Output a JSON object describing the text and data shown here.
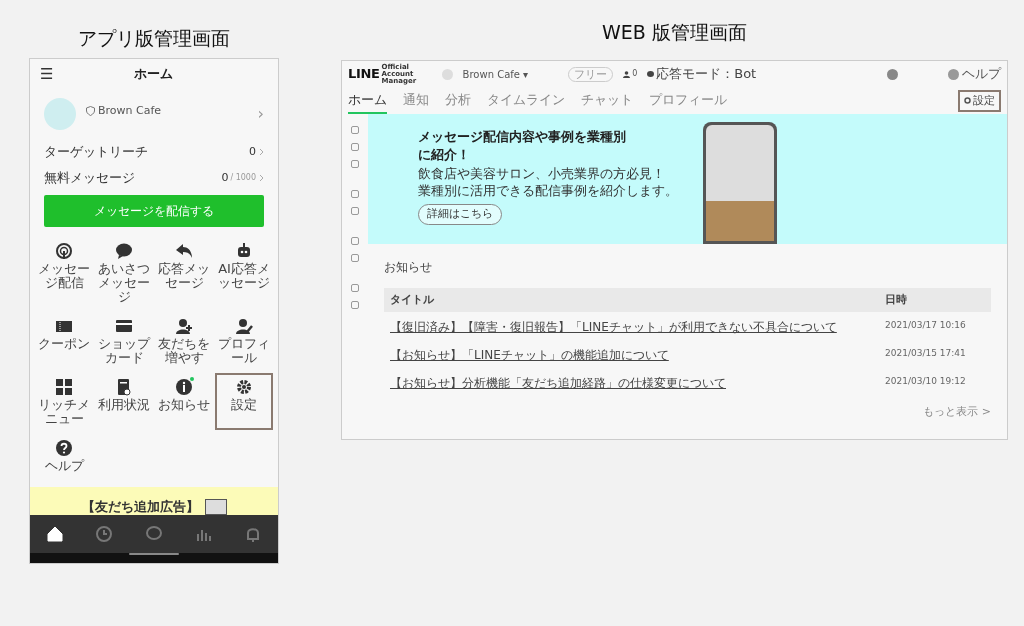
{
  "app": {
    "heading": "アプリ版管理画面",
    "header": {
      "menu": "☰",
      "title": "ホーム"
    },
    "account": {
      "name": "Brown Cafe",
      "chevron": "›"
    },
    "stats": [
      {
        "label": "ターゲットリーチ",
        "value": "0"
      },
      {
        "label": "無料メッセージ",
        "value": "0",
        "limit": "/ 1000"
      }
    ],
    "primary_button": "メッセージを配信する",
    "menu": [
      {
        "label": "メッセージ配信",
        "highlighted": false,
        "new": false
      },
      {
        "label": "あいさつメッセージ",
        "highlighted": false,
        "new": false
      },
      {
        "label": "応答メッセージ",
        "highlighted": false,
        "new": false
      },
      {
        "label": "AI応答メッセージ",
        "highlighted": false,
        "new": false
      },
      {
        "label": "クーポン",
        "highlighted": false,
        "new": false
      },
      {
        "label": "ショップカード",
        "highlighted": false,
        "new": false
      },
      {
        "label": "友だちを増やす",
        "highlighted": false,
        "new": false
      },
      {
        "label": "プロフィール",
        "highlighted": false,
        "new": false
      },
      {
        "label": "リッチメニュー",
        "highlighted": false,
        "new": false
      },
      {
        "label": "利用状況",
        "highlighted": false,
        "new": false
      },
      {
        "label": "お知らせ",
        "highlighted": false,
        "new": true
      },
      {
        "label": "設定",
        "highlighted": true,
        "new": false
      },
      {
        "label": "ヘルプ",
        "highlighted": false,
        "new": false
      }
    ],
    "banner": "【友だち追加広告】",
    "bottom_nav": [
      {
        "selected": true
      },
      {
        "selected": false
      },
      {
        "selected": false
      },
      {
        "selected": false
      },
      {
        "selected": false
      }
    ]
  },
  "web": {
    "heading": "WEB 版管理画面",
    "logo": {
      "main": "LINE",
      "sub": "Official Account Manager"
    },
    "account": {
      "name": "Brown Cafe ▾",
      "plan": "フリー",
      "friends": "0",
      "mode": "応答モード：Bot"
    },
    "help": "ヘルプ",
    "tabs": [
      {
        "label": "ホーム",
        "selected": true
      },
      {
        "label": "通知",
        "selected": false
      },
      {
        "label": "分析",
        "selected": false
      },
      {
        "label": "タイムライン",
        "selected": false
      },
      {
        "label": "チャット",
        "selected": false
      },
      {
        "label": "プロフィール",
        "selected": false
      }
    ],
    "settings_button": {
      "label": "設定",
      "highlighted": true
    },
    "promo": {
      "title": "メッセージ配信内容や事例を業種別に紹介！",
      "lines": [
        "飲食店や美容サロン、小売業界の方必見！",
        "業種別に活用できる配信事例を紹介します。"
      ],
      "button": "詳細はこちら"
    },
    "notices": {
      "title": "お知らせ",
      "columns": [
        "タイトル",
        "日時"
      ],
      "rows": [
        [
          "【復旧済み】【障害・復旧報告】「LINEチャット」が利用できない不具合について",
          "2021/03/17 10:16"
        ],
        [
          "【お知らせ】「LINEチャット」の機能追加について",
          "2021/03/15 17:41"
        ],
        [
          "【お知らせ】分析機能「友だち追加経路」の仕様変更について",
          "2021/03/10 19:12"
        ]
      ],
      "more": "もっと表示 >"
    }
  }
}
